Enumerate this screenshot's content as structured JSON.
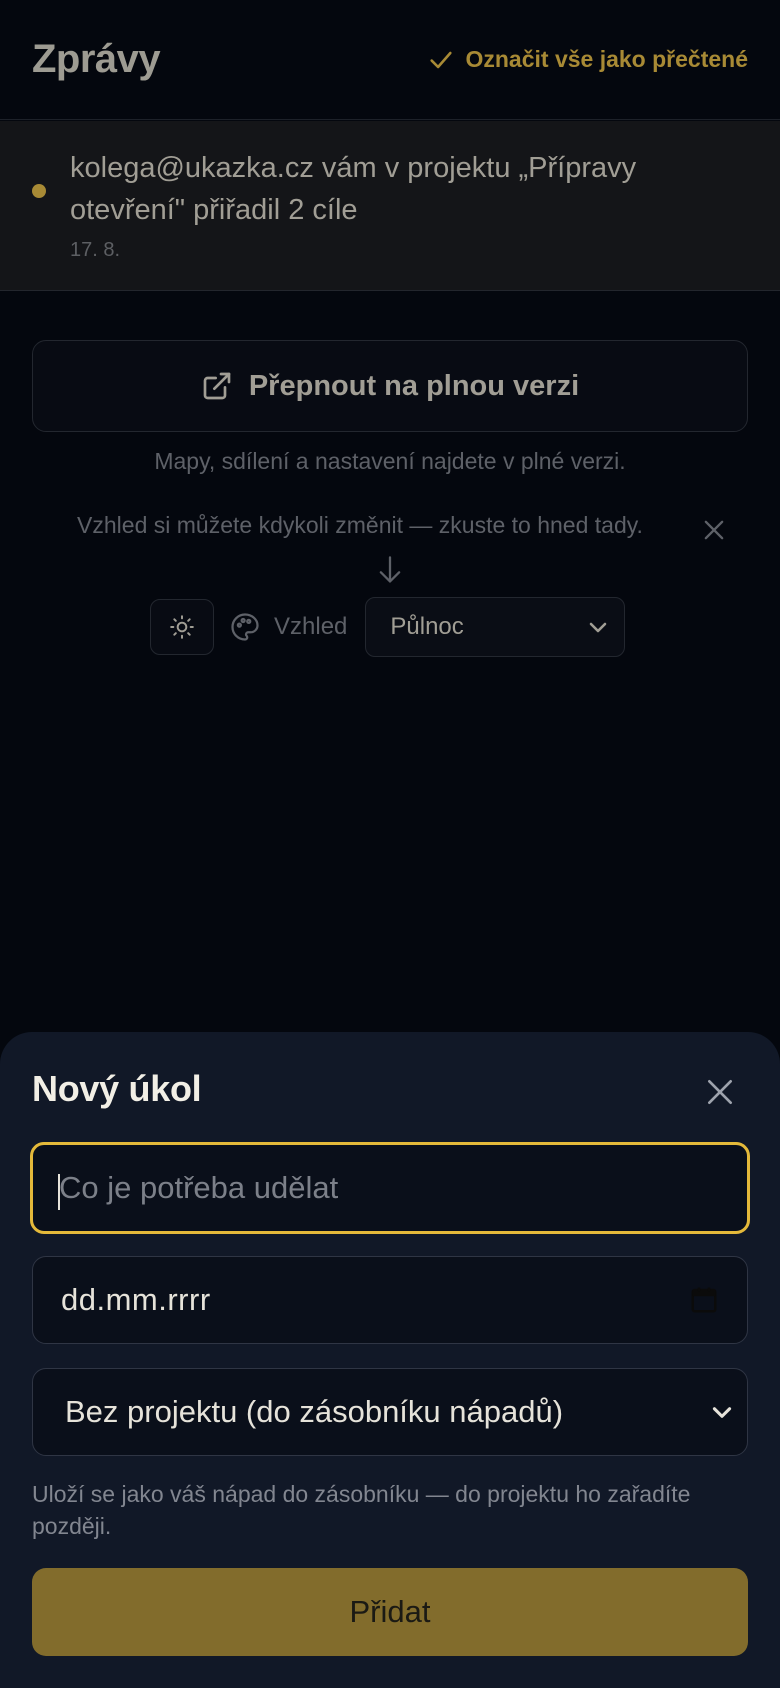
{
  "header": {
    "title": "Zprávy",
    "mark_all_label": "Označit vše jako přečtené"
  },
  "notification": {
    "text": "kolega@ukazka.cz vám v projektu „Přípravy otevření\" přiřadil 2 cíle",
    "date": "17. 8.",
    "unread": true
  },
  "full_version": {
    "button_label": "Přepnout na plnou verzi",
    "hint": "Mapy, sdílení a nastavení najdete v plné verzi."
  },
  "appearance": {
    "hint": "Vzhled si můžete kdykoli změnit — zkuste to hned tady.",
    "label": "Vzhled",
    "selected_theme": "Půlnoc"
  },
  "new_task": {
    "title": "Nový úkol",
    "task_placeholder": "Co je potřeba udělat",
    "date_placeholder": "dd.mm.rrrr",
    "project_selected": "Bez projektu (do zásobníku nápadů)",
    "hint": "Uloží se jako váš nápad do zásobníku — do projektu ho zařadíte později.",
    "add_label": "Přidat"
  },
  "colors": {
    "accent": "#a88a35",
    "focus_border": "#e4b93a",
    "add_button": "#826c2c",
    "sheet_bg": "#111827"
  }
}
